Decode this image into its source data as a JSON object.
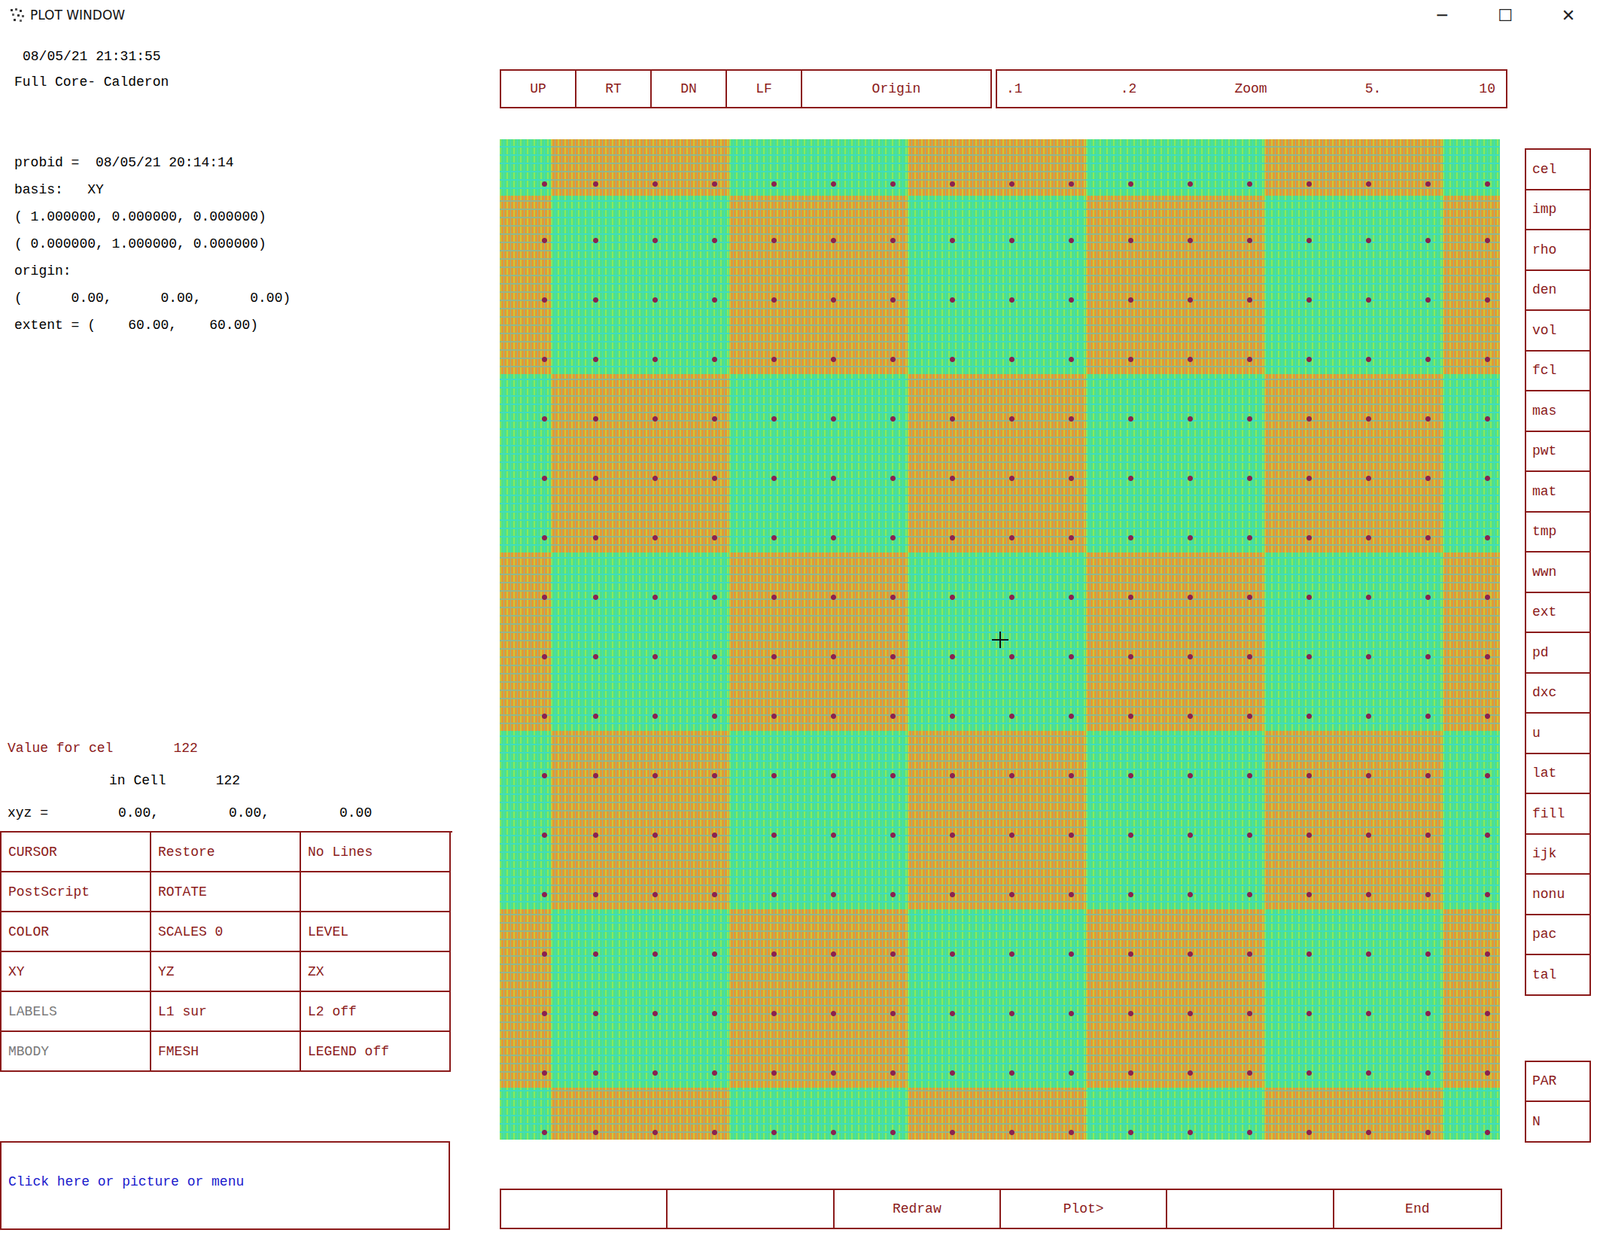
{
  "window": {
    "title": "PLOT WINDOW",
    "controls": [
      "─",
      "☐",
      "✕"
    ]
  },
  "header": {
    "timestamp": "08/05/21 21:31:55",
    "title": "Full Core- Calderon"
  },
  "info": [
    "probid =  08/05/21 20:14:14",
    "basis:   XY",
    "( 1.000000, 0.000000, 0.000000)",
    "( 0.000000, 1.000000, 0.000000)",
    "origin:",
    "(      0.00,      0.00,      0.00)",
    "extent = (    60.00,    60.00)"
  ],
  "readout": {
    "value_label": "Value for cel",
    "value": "122",
    "cell_label": "in Cell",
    "cell": "122",
    "xyz_label": "xyz =",
    "xyz": [
      "0.00,",
      "0.00,",
      "0.00"
    ]
  },
  "commands": [
    {
      "label": "CURSOR",
      "disabled": false
    },
    {
      "label": "Restore",
      "disabled": false
    },
    {
      "label": "No Lines",
      "disabled": false
    },
    {
      "label": "PostScript",
      "disabled": false
    },
    {
      "label": "ROTATE",
      "disabled": false
    },
    {
      "label": "",
      "disabled": false
    },
    {
      "label": "COLOR",
      "disabled": false
    },
    {
      "label": "SCALES 0",
      "disabled": false
    },
    {
      "label": "LEVEL",
      "disabled": false
    },
    {
      "label": "XY",
      "disabled": false
    },
    {
      "label": "YZ",
      "disabled": false
    },
    {
      "label": "ZX",
      "disabled": false
    },
    {
      "label": "LABELS",
      "disabled": true
    },
    {
      "label": "L1 sur",
      "disabled": false
    },
    {
      "label": "L2 off",
      "disabled": false
    },
    {
      "label": "MBODY",
      "disabled": true
    },
    {
      "label": "FMESH",
      "disabled": false
    },
    {
      "label": "LEGEND off",
      "disabled": false
    }
  ],
  "prompt": "Click here or picture or menu",
  "nav": [
    "UP",
    "RT",
    "DN",
    "LF",
    "Origin"
  ],
  "zoom": [
    ".1",
    ".2",
    "Zoom",
    "5.",
    "10"
  ],
  "quantities": [
    "cel",
    "imp",
    "rho",
    "den",
    "vol",
    "fcl",
    "mas",
    "pwt",
    "mat",
    "tmp",
    "wwn",
    "ext",
    "pd",
    "dxc",
    "u",
    "lat",
    "fill",
    "ijk",
    "nonu",
    "pac",
    "tal"
  ],
  "extra": [
    "PAR",
    "N"
  ],
  "bottom": [
    "",
    "",
    "Redraw",
    "Plot>",
    "",
    "End"
  ],
  "plot": {
    "assemblies": [
      [
        {
          "color": "#4fe08a"
        },
        {
          "color": "#e39a34"
        },
        {
          "color": "#4fe08a"
        },
        {
          "color": "#e39a34"
        },
        {
          "color": "#4fe08a"
        },
        {
          "color": "#e39a34"
        },
        {
          "color": "#4fe08a"
        }
      ],
      [
        {
          "color": "#e39a34"
        },
        {
          "color": "#4fe08a"
        },
        {
          "color": "#e39a34"
        },
        {
          "color": "#4fe08a"
        },
        {
          "color": "#e39a34"
        },
        {
          "color": "#4fe08a"
        },
        {
          "color": "#e39a34"
        }
      ],
      [
        {
          "color": "#4fe08a"
        },
        {
          "color": "#e39a34"
        },
        {
          "color": "#4fe08a"
        },
        {
          "color": "#e39a34"
        },
        {
          "color": "#4fe08a"
        },
        {
          "color": "#e39a34"
        },
        {
          "color": "#4fe08a"
        }
      ],
      [
        {
          "color": "#e39a34"
        },
        {
          "color": "#4fe08a"
        },
        {
          "color": "#e39a34"
        },
        {
          "color": "#4fe08a"
        },
        {
          "color": "#e39a34"
        },
        {
          "color": "#4fe08a"
        },
        {
          "color": "#e39a34"
        }
      ],
      [
        {
          "color": "#4fe08a"
        },
        {
          "color": "#e39a34"
        },
        {
          "color": "#4fe08a"
        },
        {
          "color": "#e39a34"
        },
        {
          "color": "#4fe08a"
        },
        {
          "color": "#e39a34"
        },
        {
          "color": "#4fe08a"
        }
      ],
      [
        {
          "color": "#e39a34"
        },
        {
          "color": "#4fe08a"
        },
        {
          "color": "#e39a34"
        },
        {
          "color": "#4fe08a"
        },
        {
          "color": "#e39a34"
        },
        {
          "color": "#4fe08a"
        },
        {
          "color": "#e39a34"
        }
      ],
      [
        {
          "color": "#4fe08a"
        },
        {
          "color": "#e39a34"
        },
        {
          "color": "#4fe08a"
        },
        {
          "color": "#e39a34"
        },
        {
          "color": "#4fe08a"
        },
        {
          "color": "#e39a34"
        },
        {
          "color": "#4fe08a"
        }
      ]
    ]
  }
}
